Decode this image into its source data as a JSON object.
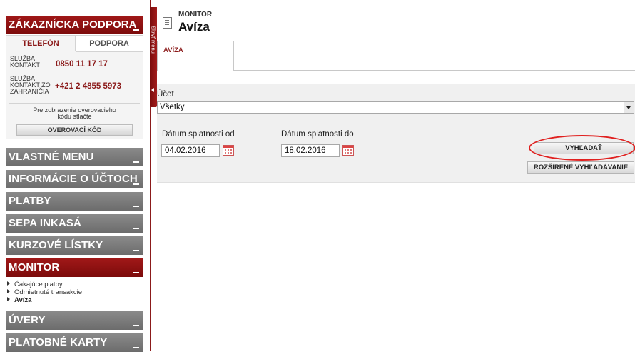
{
  "sidebar": {
    "support_header": "ZÁKAZNÍCKA PODPORA",
    "tabs": [
      "TELEFÓN",
      "PODPORA"
    ],
    "contacts": [
      {
        "label_line1": "SLUŽBA",
        "label_line2": "KONTAKT",
        "label_line3": "",
        "number": "0850 11 17 17"
      },
      {
        "label_line1": "SLUŽBA",
        "label_line2": "KONTAKT ZO",
        "label_line3": "ZAHRANIČIA",
        "number": "+421 2 4855 5973"
      }
    ],
    "verify_text_line1": "Pre zobrazenie overovacieho",
    "verify_text_line2": "kódu stlačte",
    "verify_button": "OVEROVACÍ KÓD",
    "menu": [
      {
        "label": "VLASTNÉ MENU",
        "active": false
      },
      {
        "label": "INFORMÁCIE O ÚČTOCH",
        "active": false
      },
      {
        "label": "PLATBY",
        "active": false
      },
      {
        "label": "SEPA INKASÁ",
        "active": false
      },
      {
        "label": "KURZOVÉ LÍSTKY",
        "active": false
      },
      {
        "label": "MONITOR",
        "active": true
      },
      {
        "label": "ÚVERY",
        "active": false
      },
      {
        "label": "PLATOBNÉ KARTY",
        "active": false
      }
    ],
    "monitor_submenu": [
      {
        "label": "Čakajúce platby",
        "active": false
      },
      {
        "label": "Odmietnuté transakcie",
        "active": false
      },
      {
        "label": "Avíza",
        "active": true
      }
    ],
    "hide_menu_label": "Skryť menu"
  },
  "header": {
    "breadcrumb": "MONITOR",
    "title": "Avíza"
  },
  "main": {
    "tab": "AVÍZA",
    "account_label": "Účet",
    "account_value": "Všetky",
    "date_from_label": "Dátum splatnosti od",
    "date_from_value": "04.02.2016",
    "date_to_label": "Dátum splatnosti do",
    "date_to_value": "18.02.2016",
    "search_button": "VYHĽADAŤ",
    "advanced_search_button": "ROZŠÍRENÉ VYHĽADÁVANIE"
  },
  "colors": {
    "brand_red": "#8b1a1a",
    "menu_gray": "#7a7a7a",
    "highlight_ellipse": "#e0201f"
  }
}
